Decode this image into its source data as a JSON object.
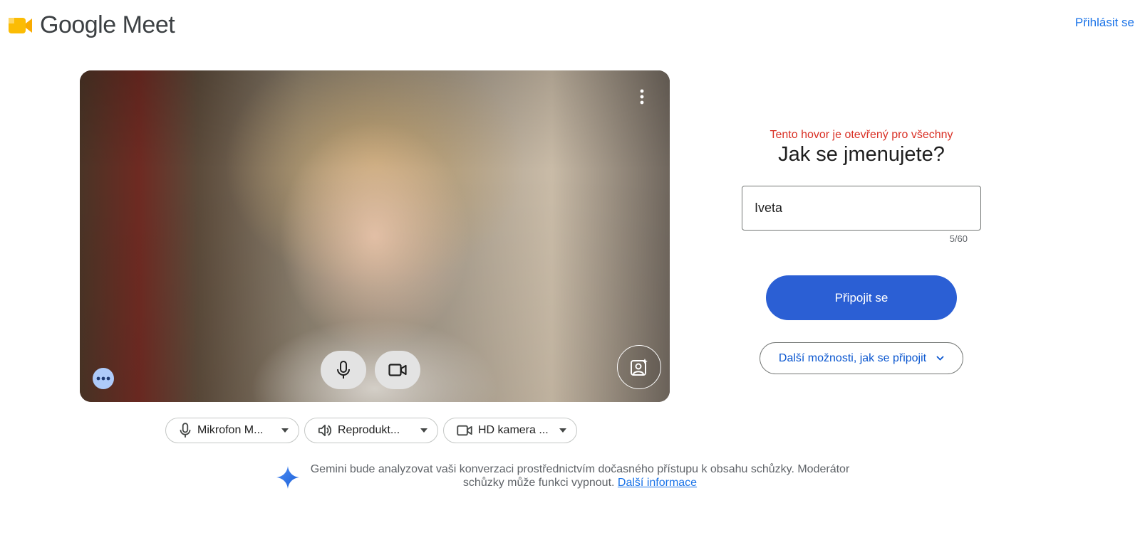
{
  "header": {
    "app_name": "Google Meet",
    "signin_label": "Přihlásit se"
  },
  "preview": {
    "camera_on": true,
    "mic_on": true
  },
  "devices": [
    {
      "icon": "microphone-icon",
      "label": "Mikrofon M..."
    },
    {
      "icon": "speaker-icon",
      "label": "Reprodukt..."
    },
    {
      "icon": "camera-icon",
      "label": "HD kamera ..."
    }
  ],
  "gemini": {
    "text": "Gemini bude analyzovat vaši konverzaci prostřednictvím dočasného přístupu k obsahu schůzky. Moderátor schůzky může funkci vypnout.",
    "link_label": "Další informace"
  },
  "join_panel": {
    "open_note": "Tento hovor je otevřený pro všechny",
    "title": "Jak se jmenujete?",
    "name_value": "Iveta",
    "counter": "5/60",
    "join_label": "Připojit se",
    "other_options_label": "Další možnosti, jak se připojit"
  },
  "colors": {
    "accent": "#1a73e8",
    "join_button": "#2b5fd4",
    "warning": "#d93025"
  }
}
